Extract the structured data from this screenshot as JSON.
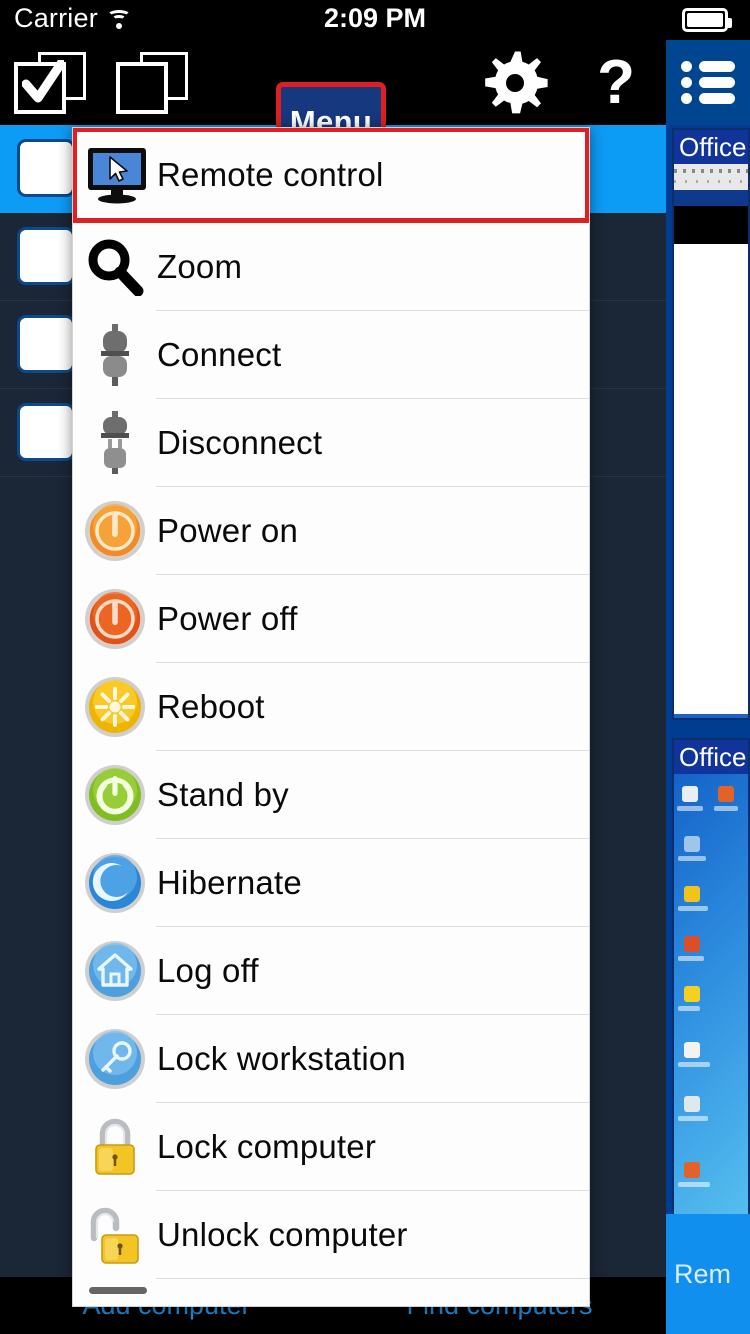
{
  "status_bar": {
    "carrier": "Carrier",
    "time": "2:09 PM",
    "wifi_icon": "wifi-icon",
    "battery_icon": "battery-icon"
  },
  "toolbar": {
    "select_all_icon": "select-all-icon",
    "deselect_all_icon": "deselect-all-icon",
    "menu_label": "Menu",
    "settings_icon": "gear-icon",
    "help_label": "?",
    "list_view_icon": "list-view-icon",
    "highlight_color": "#e02020",
    "menu_button_color": "#16387e"
  },
  "menu": {
    "title": "Menu",
    "highlighted_index": 0,
    "items": [
      {
        "label": "Remote control",
        "icon": "monitor-cursor-icon"
      },
      {
        "label": "Zoom",
        "icon": "magnifier-icon"
      },
      {
        "label": "Connect",
        "icon": "plug-connected-icon"
      },
      {
        "label": "Disconnect",
        "icon": "plug-disconnected-icon"
      },
      {
        "label": "Power on",
        "icon": "power-on-orb-icon"
      },
      {
        "label": "Power off",
        "icon": "power-off-orb-icon"
      },
      {
        "label": "Reboot",
        "icon": "reboot-orb-icon"
      },
      {
        "label": "Stand by",
        "icon": "standby-orb-icon"
      },
      {
        "label": "Hibernate",
        "icon": "hibernate-moon-icon"
      },
      {
        "label": "Log off",
        "icon": "logoff-home-icon"
      },
      {
        "label": "Lock workstation",
        "icon": "key-orb-icon"
      },
      {
        "label": "Lock computer",
        "icon": "padlock-closed-icon"
      },
      {
        "label": "Unlock computer",
        "icon": "padlock-open-icon"
      }
    ]
  },
  "computer_list": {
    "selected_row": 0,
    "rows": [
      {
        "thumbnail": "computer-thumbnail"
      },
      {
        "thumbnail": "computer-thumbnail"
      },
      {
        "thumbnail": "computer-thumbnail"
      },
      {
        "thumbnail": "computer-thumbnail"
      }
    ],
    "selected_color": "#0d9cf5",
    "background_color": "#1b2636"
  },
  "previews": [
    {
      "title": "Office"
    },
    {
      "title": "Office"
    }
  ],
  "bottom_bar": {
    "tabs": [
      {
        "label": "Add computer"
      },
      {
        "label": "Find computers"
      }
    ],
    "remote_label": "Rem",
    "remote_color": "#118fef"
  }
}
